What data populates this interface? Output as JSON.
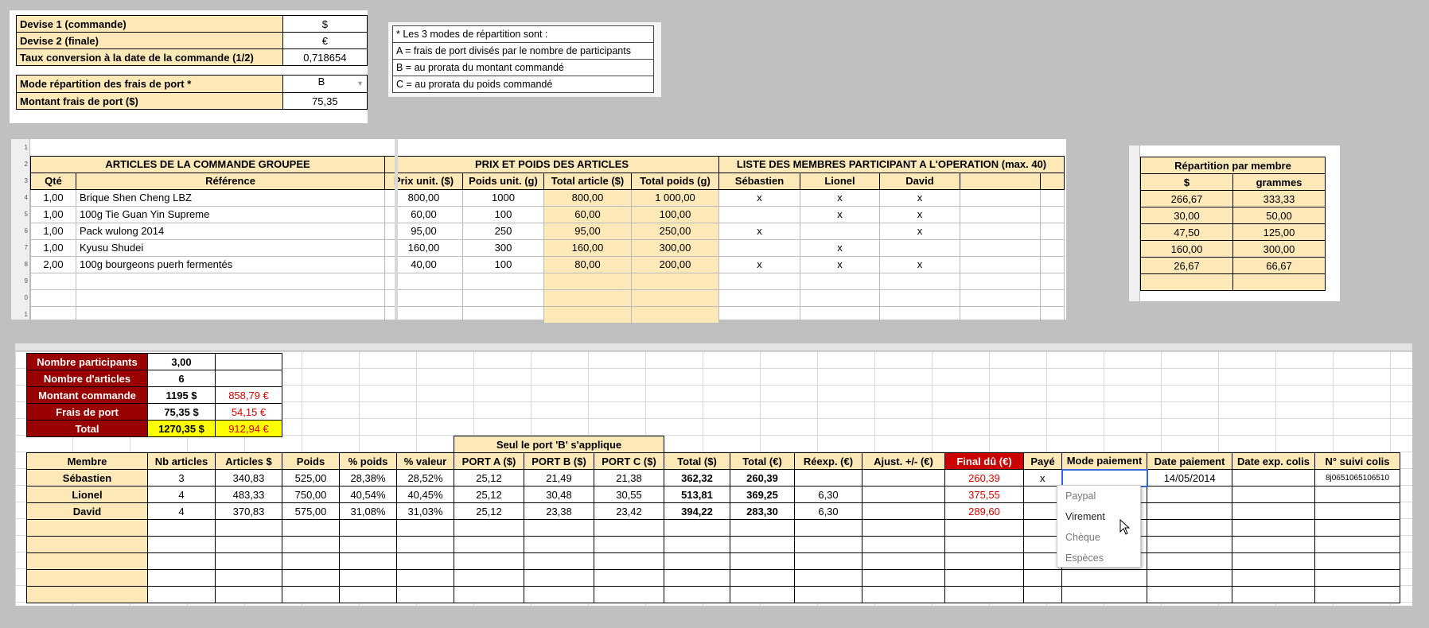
{
  "settings": {
    "rows": [
      {
        "label": "Devise 1 (commande)",
        "value": "$"
      },
      {
        "label": "Devise 2 (finale)",
        "value": "€"
      },
      {
        "label": "Taux conversion à la date de la commande (1/2)",
        "value": "0,718654"
      }
    ],
    "rows2": [
      {
        "label": "Mode répartition des frais de port *",
        "value": "B"
      },
      {
        "label": "Montant frais de port ($)",
        "value": "75,35"
      }
    ]
  },
  "legend": {
    "lines": [
      "* Les 3 modes de répartition sont :",
      "A = frais de port divisés par le nombre de participants",
      "B = au prorata du montant commandé",
      "C = au prorata du poids commandé"
    ]
  },
  "articles": {
    "row_numbers": [
      "1",
      "2",
      "3",
      "4",
      "5",
      "6",
      "7",
      "8",
      "9",
      "0",
      "1"
    ],
    "headers_top": {
      "articles": "ARTICLES DE LA COMMANDE GROUPEE",
      "prix": "PRIX ET POIDS DES ARTICLES",
      "membres": "LISTE DES MEMBRES PARTICIPANT A L'OPERATION (max. 40)"
    },
    "headers": [
      "Qté",
      "Référence",
      "Prix unit. ($)",
      "Poids unit. (g)",
      "Total article ($)",
      "Total poids (g)",
      "Sébastien",
      "Lionel",
      "David",
      ""
    ],
    "rows": [
      [
        "1,00",
        "Brique Shen Cheng LBZ",
        "800,00",
        "1000",
        "800,00",
        "1 000,00",
        "x",
        "x",
        "x",
        ""
      ],
      [
        "1,00",
        "100g Tie Guan Yin Supreme",
        "60,00",
        "100",
        "60,00",
        "100,00",
        "",
        "x",
        "x",
        ""
      ],
      [
        "1,00",
        "Pack wulong 2014",
        "95,00",
        "250",
        "95,00",
        "250,00",
        "x",
        "",
        "x",
        ""
      ],
      [
        "1,00",
        "Kyusu Shudei",
        "160,00",
        "300",
        "160,00",
        "300,00",
        "",
        "x",
        "",
        ""
      ],
      [
        "2,00",
        "100g bourgeons puerh fermentés",
        "40,00",
        "100",
        "80,00",
        "200,00",
        "x",
        "x",
        "x",
        ""
      ]
    ]
  },
  "repartition": {
    "title": "Répartition par membre",
    "headers": [
      "$",
      "grammes"
    ],
    "rows": [
      [
        "266,67",
        "333,33"
      ],
      [
        "30,00",
        "50,00"
      ],
      [
        "47,50",
        "125,00"
      ],
      [
        "160,00",
        "300,00"
      ],
      [
        "26,67",
        "66,67"
      ]
    ]
  },
  "stats": [
    {
      "label": "Nombre participants",
      "v1": "3,00",
      "v2": ""
    },
    {
      "label": "Nombre d'articles",
      "v1": "6",
      "v2": ""
    },
    {
      "label": "Montant commande",
      "v1": "1195 $",
      "v2": "858,79 €"
    },
    {
      "label": "Frais de port",
      "v1": "75,35 $",
      "v2": "54,15 €"
    },
    {
      "label": "Total",
      "v1": "1270,35 $",
      "v2": "912,94 €"
    }
  ],
  "main": {
    "seul": "Seul le port 'B' s'applique",
    "headers": [
      "Membre",
      "Nb articles",
      "Articles $",
      "Poids",
      "% poids",
      "% valeur",
      "PORT A ($)",
      "PORT B ($)",
      "PORT C ($)",
      "Total ($)",
      "Total (€)",
      "Réexp. (€)",
      "Ajust. +/- (€)",
      "Final dû (€)",
      "Payé",
      "Mode paiement",
      "Date paiement",
      "Date exp. colis",
      "N° suivi colis"
    ],
    "rows": [
      [
        "Sébastien",
        "3",
        "340,83",
        "525,00",
        "28,38%",
        "28,52%",
        "25,12",
        "21,49",
        "21,38",
        "362,32",
        "260,39",
        "",
        "",
        "260,39",
        "x",
        "",
        "14/05/2014",
        "",
        "8j0651065106510"
      ],
      [
        "Lionel",
        "4",
        "483,33",
        "750,00",
        "40,54%",
        "40,45%",
        "25,12",
        "30,48",
        "30,55",
        "513,81",
        "369,25",
        "6,30",
        "",
        "375,55",
        "",
        "",
        "",
        "",
        ""
      ],
      [
        "David",
        "4",
        "370,83",
        "575,00",
        "31,08%",
        "31,03%",
        "25,12",
        "23,38",
        "23,42",
        "394,22",
        "283,30",
        "6,30",
        "",
        "289,60",
        "",
        "",
        "",
        "",
        ""
      ]
    ]
  },
  "dropdown": {
    "options": [
      "Paypal",
      "Virement",
      "Chèque",
      "Espèces"
    ],
    "hovered": "Virement"
  },
  "colors": {
    "header_bg": "#fde9b8",
    "stat_label_bg": "#990000",
    "final_header_bg": "#cc0000",
    "total_highlight": "#ffff00",
    "euro_text": "#e00000"
  }
}
